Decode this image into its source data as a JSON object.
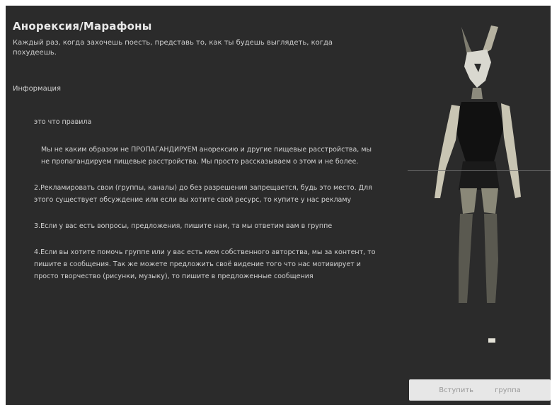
{
  "group": {
    "title": "Анорексия/Марафоны",
    "subtitle": "Каждый раз, когда захочешь поесть, представь то, как ты будешь выглядеть, когда похудеешь.",
    "section_label": "Информация"
  },
  "rules": {
    "heading": "это что правила",
    "items": [
      "Мы не каким образом не ПРОПАГАНДИРУЕМ анорексию и другие пищевые расстройства, мы не пропагандируем пищевые расстройства. Мы просто рассказываем о этом и не более.",
      "2.Рекламировать свои (группы, каналы) до без разрешения запрещается, будь это место. Для этого существует обсуждение или если вы хотите свой ресурс, то купите у нас рекламу",
      "3.Если у вас есть вопросы, предложения, пишите нам, та мы ответим вам в группе",
      "4.Если вы хотите помочь группе или у вас есть мем собственного авторства, мы за контент, то пишите в сообщения. Так же можете предложить своё видение того что нас мотивирует и просто творчество (рисунки, музыку), то пишите в предложенные сообщения"
    ]
  },
  "actions": {
    "join_label": "Вступить",
    "group_label": "группа"
  },
  "colors": {
    "panel_bg": "#2b2b2b",
    "text": "#d2d2d2",
    "button_bg": "#e7e7e7"
  }
}
